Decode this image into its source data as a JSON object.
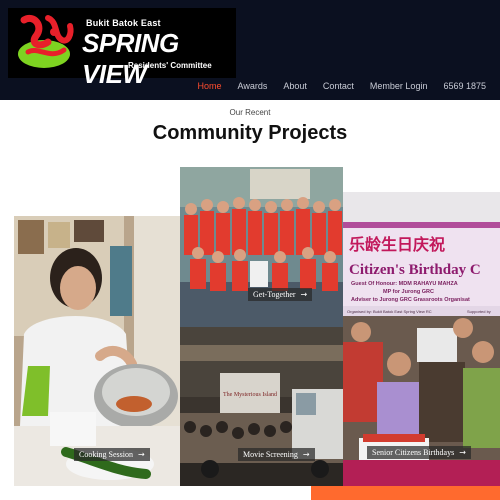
{
  "header": {
    "logo": {
      "estate": "Bukit Batok East",
      "name": "SPRING VIEW",
      "subtitle": "Residents' Committee"
    },
    "nav": [
      {
        "label": "Home",
        "active": true
      },
      {
        "label": "Awards",
        "active": false
      },
      {
        "label": "About",
        "active": false
      },
      {
        "label": "Contact",
        "active": false
      },
      {
        "label": "Member Login",
        "active": false
      },
      {
        "label": "6569 1875",
        "active": false
      }
    ]
  },
  "section": {
    "eyebrow": "Our Recent",
    "title": "Community Projects"
  },
  "projects": [
    {
      "label": "Cooking Session",
      "arrow": "→"
    },
    {
      "label": "Get-Together",
      "arrow": "→"
    },
    {
      "label": "Movie Screening",
      "arrow": "→"
    },
    {
      "label": "Senior Citizens Birthdays",
      "arrow": "→"
    }
  ],
  "photo_text": {
    "banner_chinese": "乐龄生日庆祝",
    "banner_english": "Citizen's Birthday C",
    "banner_guest": "Guest Of Honour: MDM RAHAYU MAHZA",
    "banner_mp": "MP for Jurong GRC",
    "banner_adviser": "Adviser to Jurong GRC Grassroots Organisat",
    "banner_org": "Organised by: Bukit Batok East Spring View RC",
    "banner_support": "Supported by",
    "movie_sign": "The Mysterious Island"
  },
  "colors": {
    "header_bg": "#0b1020",
    "nav_active": "#ff4d2e",
    "accent_bar": "#ff6a2e",
    "logo_green": "#7ed321",
    "logo_red": "#e8202a"
  }
}
